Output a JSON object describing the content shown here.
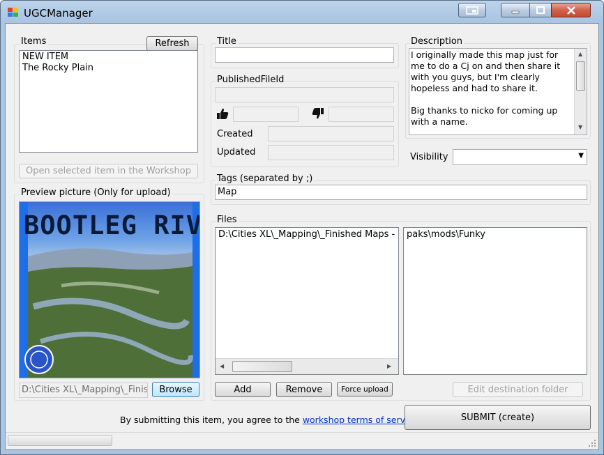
{
  "window": {
    "title": "UGCManager"
  },
  "items_group": {
    "label": "Items",
    "refresh_label": "Refresh",
    "items": [
      "NEW ITEM",
      "The Rocky Plain"
    ],
    "open_workshop_label": "Open selected item in the Workshop"
  },
  "preview_group": {
    "label": "Preview picture (Only for upload)",
    "image_text": "BOOTLEG RIVER",
    "path_value": "D:\\Cities XL\\_Mapping\\_Finish",
    "browse_label": "Browse"
  },
  "title_group": {
    "label": "Title",
    "value": ""
  },
  "published_group": {
    "label": "PublishedFileId",
    "value": "",
    "upvotes": "",
    "downvotes": "",
    "created_label": "Created",
    "created_value": "",
    "updated_label": "Updated",
    "updated_value": ""
  },
  "description_group": {
    "label": "Description",
    "text": "I originally made this map just for me to do a Cj on and then share it with you guys, but I'm clearly hopeless and had to share it.\n\nBig thanks to nicko for coming up with a name."
  },
  "visibility": {
    "label": "Visibility",
    "value": ""
  },
  "tags_group": {
    "label": "Tags (separated by ;)",
    "value": "Map"
  },
  "files_group": {
    "label": "Files",
    "source_files": [
      "D:\\Cities XL\\_Mapping\\_Finished Maps - Wo"
    ],
    "destination_files": [
      "paks\\mods\\Funky"
    ],
    "add_label": "Add",
    "remove_label": "Remove",
    "force_upload_label": "Force upload",
    "edit_destination_label": "Edit destination folder"
  },
  "footer": {
    "agreement_prefix": "By submitting this item, you agree to the ",
    "agreement_link": "workshop terms of service",
    "agreement_suffix": ".",
    "submit_label": "SUBMIT (create)"
  }
}
